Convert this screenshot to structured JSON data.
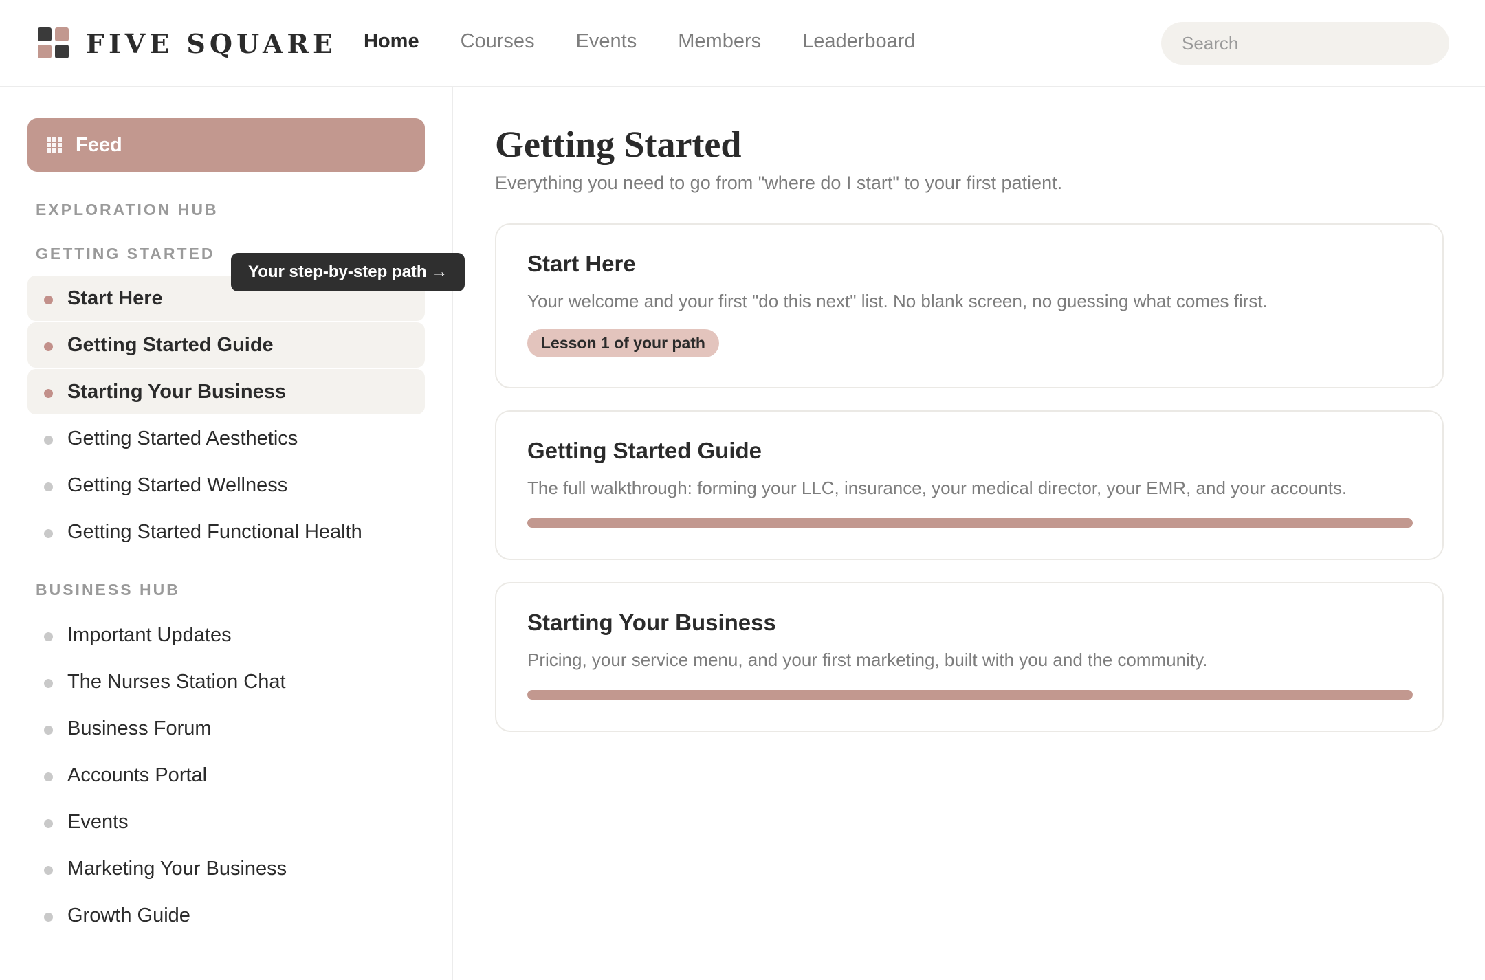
{
  "brand": {
    "name": "FIVE SQUARE"
  },
  "nav": {
    "items": [
      {
        "label": "Home",
        "active": true
      },
      {
        "label": "Courses",
        "active": false
      },
      {
        "label": "Events",
        "active": false
      },
      {
        "label": "Members",
        "active": false
      },
      {
        "label": "Leaderboard",
        "active": false
      }
    ]
  },
  "search": {
    "placeholder": "Search",
    "value": ""
  },
  "sidebar": {
    "feed_label": "Feed",
    "exploration_hub_label": "EXPLORATION HUB",
    "getting_started_label": "GETTING STARTED",
    "getting_started_items": [
      {
        "label": "Start Here",
        "highlighted": true
      },
      {
        "label": "Getting Started Guide",
        "highlighted": true
      },
      {
        "label": "Starting Your Business",
        "highlighted": true
      },
      {
        "label": "Getting Started Aesthetics",
        "highlighted": false
      },
      {
        "label": "Getting Started Wellness",
        "highlighted": false
      },
      {
        "label": "Getting Started Functional Health",
        "highlighted": false
      }
    ],
    "business_hub_label": "BUSINESS HUB",
    "business_hub_items": [
      {
        "label": "Important Updates"
      },
      {
        "label": "The Nurses Station Chat"
      },
      {
        "label": "Business Forum"
      },
      {
        "label": "Accounts Portal"
      },
      {
        "label": "Events"
      },
      {
        "label": "Marketing Your Business"
      },
      {
        "label": "Growth Guide"
      }
    ],
    "tooltip": "Your step-by-step path →"
  },
  "main": {
    "title": "Getting Started",
    "subtitle": "Everything you need to go from \"where do I start\" to your first patient.",
    "cards": [
      {
        "title": "Start Here",
        "description": "Your welcome and your first \"do this next\" list. No blank screen, no guessing what comes first.",
        "badge": "Lesson 1 of your path"
      },
      {
        "title": "Getting Started Guide",
        "description": "The full walkthrough: forming your LLC, insurance, your medical director, your EMR, and your accounts.",
        "progress": 1.0
      },
      {
        "title": "Starting Your Business",
        "description": "Pricing, your service menu, and your first marketing, built with you and the community.",
        "progress": 1.0
      }
    ]
  },
  "colors": {
    "accent": "#c2988f",
    "accent_light": "#e3c4bd",
    "highlight_bg": "#f4f2ee",
    "text_dark": "#2b2b2b",
    "text_muted": "#7d7d7d"
  }
}
